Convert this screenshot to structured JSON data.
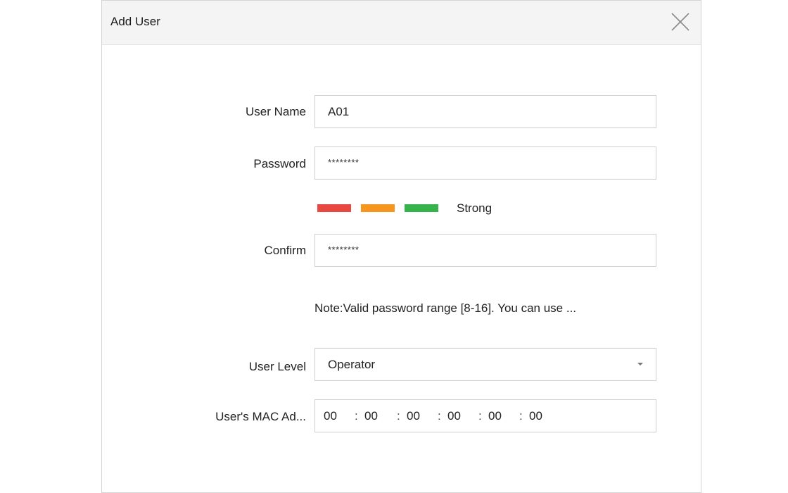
{
  "dialog": {
    "title": "Add User",
    "close_icon": "close-icon"
  },
  "form": {
    "username": {
      "label": "User Name",
      "value": "A01"
    },
    "password": {
      "label": "Password",
      "value": "********"
    },
    "strength": {
      "text": "Strong",
      "colors": [
        "#e8483f",
        "#f7961e",
        "#36b34a"
      ]
    },
    "confirm": {
      "label": "Confirm",
      "value": "********"
    },
    "note": "Note:Valid password range [8-16]. You can use ...",
    "user_level": {
      "label": "User Level",
      "value": "Operator",
      "arrow_icon": "caret-down-icon"
    },
    "mac": {
      "label": "User's MAC Ad...",
      "segments": [
        "00",
        "00",
        "00",
        "00",
        "00",
        "00"
      ],
      "separator": ":"
    }
  }
}
